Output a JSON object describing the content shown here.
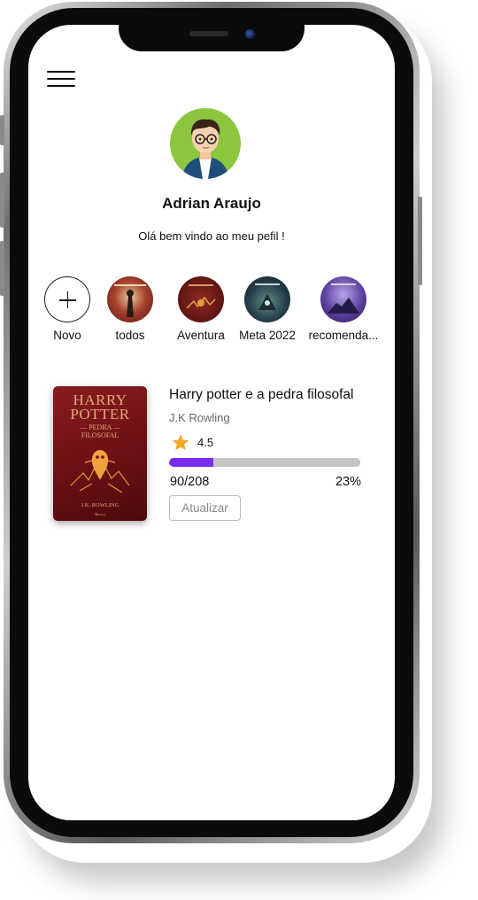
{
  "profile": {
    "name": "Adrian Araujo",
    "greeting": "Olá bem vindo ao meu pefil !"
  },
  "shelves": [
    {
      "label": "Novo",
      "icon": "plus-icon"
    },
    {
      "label": "todos"
    },
    {
      "label": "Aventura"
    },
    {
      "label": "Meta 2022"
    },
    {
      "label": "recomenda..."
    }
  ],
  "current_book": {
    "title": "Harry potter e a pedra filosofal",
    "author": "J.K Rowling",
    "rating": "4.5",
    "pages": "90/208",
    "percent": "23%",
    "progress": 0.23,
    "update_label": "Atualizar",
    "cover": {
      "title_line1": "HARRY",
      "title_line2": "POTTER",
      "subtitle_line1": "— PEDRA —",
      "subtitle_line2": "FILOSOFAL",
      "author": "J.K. ROWLING",
      "publisher": "Rocco"
    }
  },
  "colors": {
    "progress_fill": "#7b2cf1",
    "progress_track": "#c4c4c4",
    "star": "#f5a623",
    "avatar_bg": "#8cc63f"
  }
}
